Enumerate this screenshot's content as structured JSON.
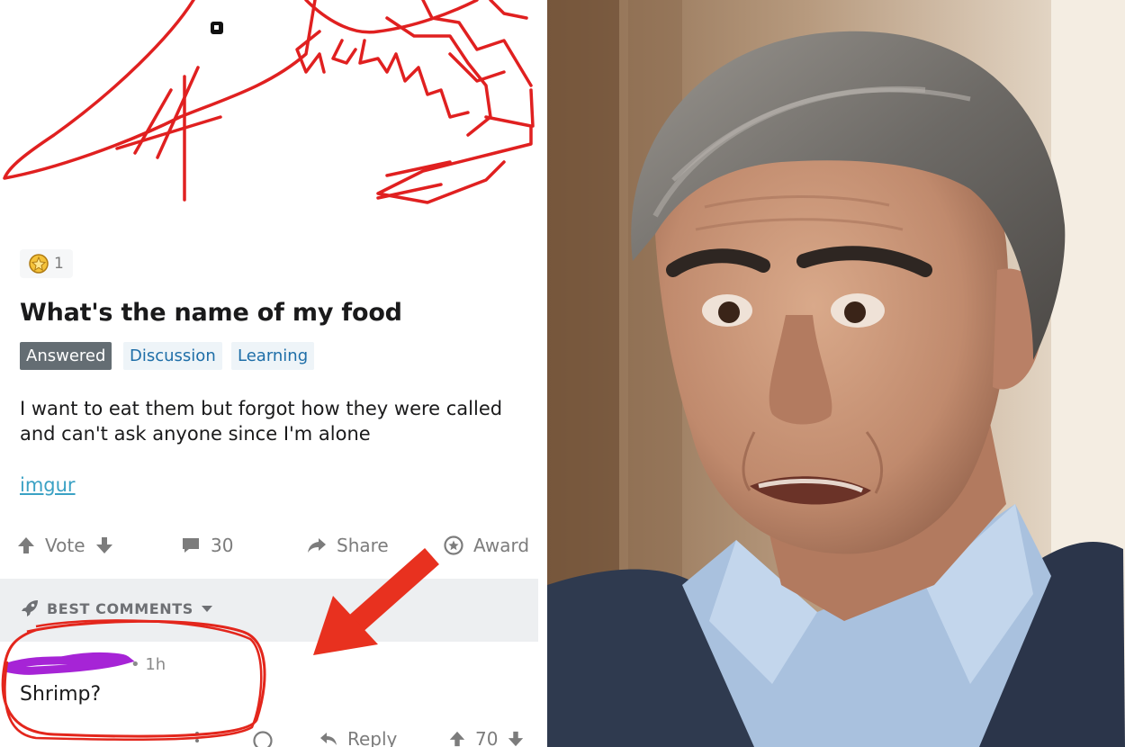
{
  "post": {
    "award_count": "1",
    "title": "What's the name of my food",
    "flairs": {
      "answered": "Answered",
      "discussion": "Discussion",
      "learning": "Learning"
    },
    "body": "I want to eat them but forgot how they were called and can't ask anyone since I'm alone",
    "link": "imgur"
  },
  "actions": {
    "vote": "Vote",
    "comment_count": "30",
    "share": "Share",
    "award": "Award"
  },
  "comments_header": {
    "label": "BEST COMMENTS"
  },
  "comment": {
    "time": "• 1h",
    "text": "Shrimp?",
    "reply": "Reply",
    "vote_count": "70"
  },
  "colors": {
    "drawing_red": "#e02020",
    "highlight_red": "#e3261c",
    "scribble_purple": "#a624d6",
    "flair_answered_bg": "#646d73",
    "flair_blue": "#1e6ea8",
    "link_blue": "#3aa1c4"
  },
  "icons": {
    "award_badge": "award-badge-icon",
    "upvote": "arrow-up-icon",
    "downvote": "arrow-down-icon",
    "comment": "comment-bubble-icon",
    "share": "share-arrow-icon",
    "award": "award-outline-icon",
    "rocket": "rocket-icon",
    "caret": "caret-down-icon"
  }
}
